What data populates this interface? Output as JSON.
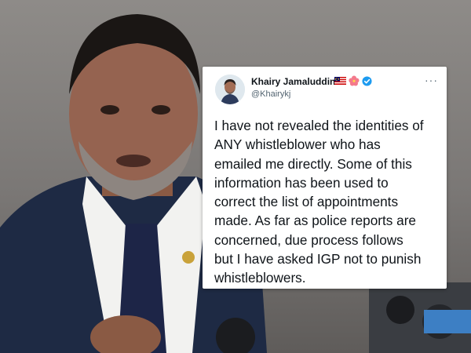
{
  "tweet": {
    "display_name": "Khairy Jamaluddin",
    "handle": "@Khairykj",
    "badges": [
      "malaysia-flag-icon",
      "hibiscus-icon",
      "verified-icon"
    ],
    "text_lines": [
      "I have not revealed the identities of",
      "ANY whistleblower who has",
      "emailed me directly. Some of this",
      "information has been used to",
      "correct the list of appointments",
      "made. As far as police reports are",
      "concerned, due process follows",
      "but I have asked IGP not to punish",
      "whistleblowers."
    ]
  },
  "colors": {
    "verified": "#1d9bf0",
    "name_text": "#0f1419",
    "handle_text": "#536471",
    "card_bg": "#ffffff"
  }
}
